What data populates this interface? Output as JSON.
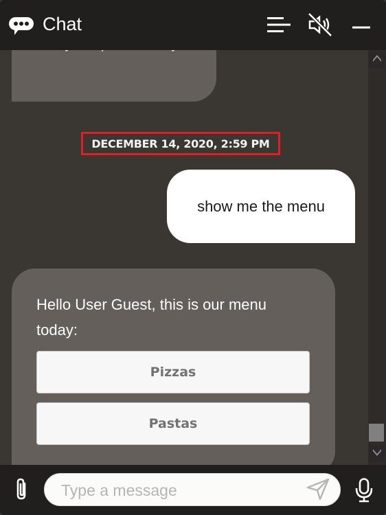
{
  "header": {
    "title": "Chat",
    "icons": {
      "logo": "chat-bubble-icon",
      "menu": "hamburger-menu-icon",
      "audio": "speaker-muted-icon",
      "minimize": "minimize-icon"
    }
  },
  "messages": [
    {
      "sender": "bot",
      "text": "Sorry, no pasta today"
    },
    {
      "type": "date-separator",
      "text": "DECEMBER 14, 2020, 2:59 PM"
    },
    {
      "sender": "user",
      "text": "show me the menu"
    },
    {
      "sender": "bot",
      "text": "Hello User Guest, this is our menu today:",
      "actions": [
        {
          "label": "Pizzas"
        },
        {
          "label": "Pastas"
        }
      ]
    }
  ],
  "composer": {
    "placeholder": "Type a message",
    "value": "",
    "icons": {
      "attach": "paperclip-icon",
      "send": "send-icon",
      "mic": "microphone-icon"
    }
  },
  "scrollbar": {
    "position_percent": 95
  },
  "colors": {
    "header_bg": "#201f1d",
    "conversation_bg": "#3a3632",
    "bot_bubble": "#645f5a",
    "user_bubble": "#ffffff",
    "highlight_border": "#e41c23"
  }
}
